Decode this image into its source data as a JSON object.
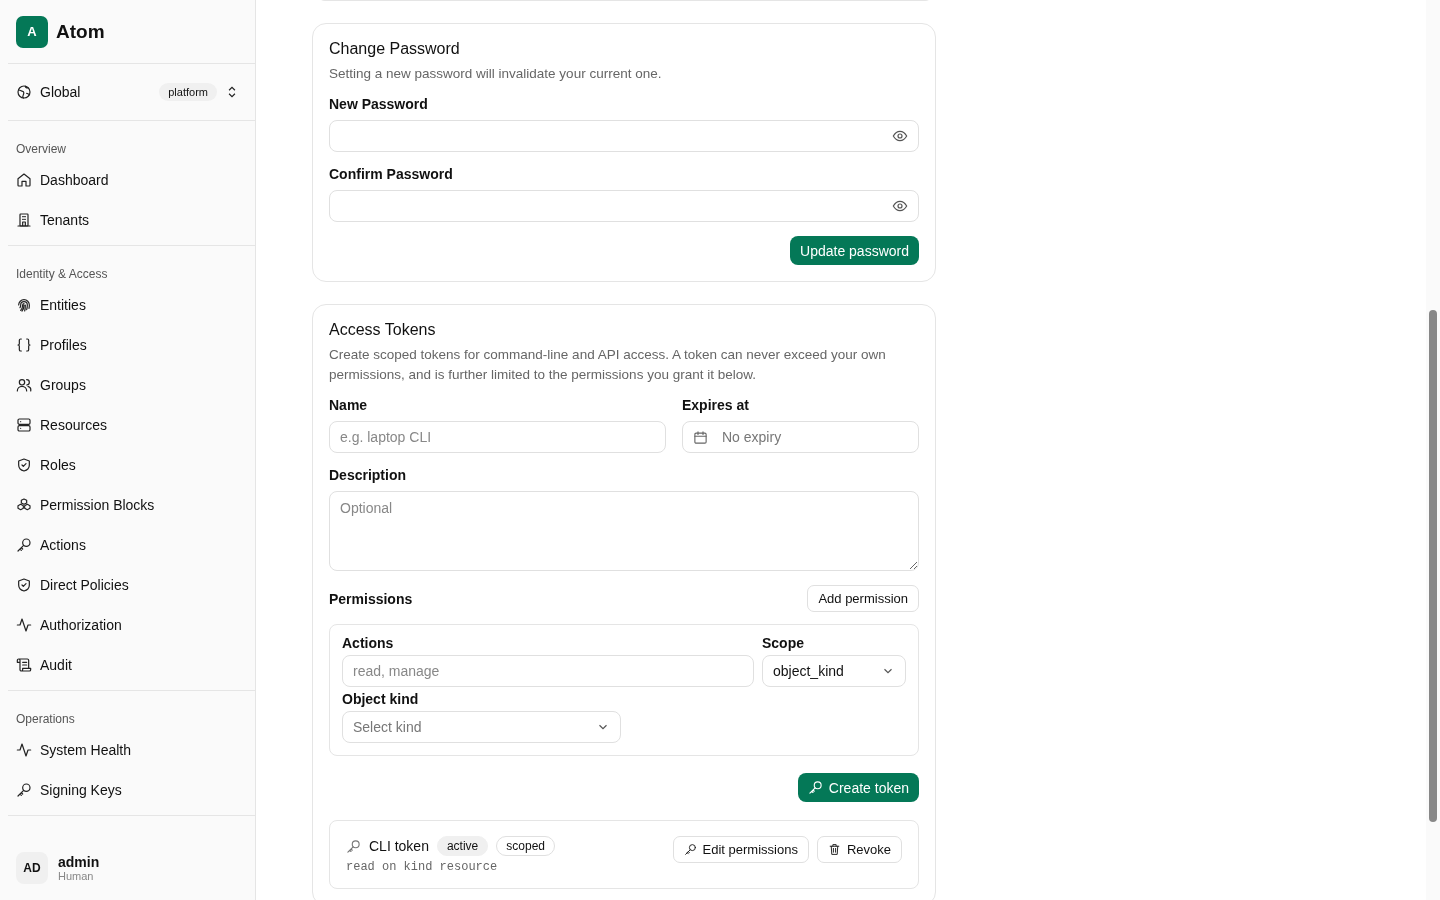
{
  "brand": {
    "initial": "A",
    "name": "Atom"
  },
  "context": {
    "name": "Global",
    "badge": "platform"
  },
  "nav": [
    {
      "section": "Overview",
      "items": [
        {
          "label": "Dashboard",
          "kind": "home"
        },
        {
          "label": "Tenants",
          "kind": "building"
        }
      ]
    },
    {
      "section": "Identity & Access",
      "items": [
        {
          "label": "Entities",
          "kind": "fingerprint"
        },
        {
          "label": "Profiles",
          "kind": "braces"
        },
        {
          "label": "Groups",
          "kind": "users"
        },
        {
          "label": "Resources",
          "kind": "server"
        },
        {
          "label": "Roles",
          "kind": "shield"
        },
        {
          "label": "Permission Blocks",
          "kind": "blocks"
        },
        {
          "label": "Actions",
          "kind": "key"
        },
        {
          "label": "Direct Policies",
          "kind": "shield"
        },
        {
          "label": "Authorization",
          "kind": "activity"
        },
        {
          "label": "Audit",
          "kind": "scroll"
        }
      ]
    },
    {
      "section": "Operations",
      "items": [
        {
          "label": "System Health",
          "kind": "activity"
        },
        {
          "label": "Signing Keys",
          "kind": "key"
        }
      ]
    }
  ],
  "user": {
    "initials": "AD",
    "name": "admin",
    "role": "Human"
  },
  "password_card": {
    "title": "Change Password",
    "description": "Setting a new password will invalidate your current one.",
    "fields": [
      {
        "label": "New Password"
      },
      {
        "label": "Confirm Password"
      }
    ],
    "button": "Update password"
  },
  "tokens_card": {
    "title": "Access Tokens",
    "description": "Create scoped tokens for command-line and API access. A token can never exceed your own permissions, and is further limited to the permissions you grant it below.",
    "name_field": {
      "label": "Name",
      "placeholder": "e.g. laptop CLI"
    },
    "expires_field": {
      "label": "Expires at",
      "value": "No expiry"
    },
    "description_field": {
      "label": "Description",
      "placeholder": "Optional"
    },
    "permissions_label": "Permissions",
    "add_button": "Add permission",
    "permission": {
      "actions_label": "Actions",
      "actions_placeholder": "read, manage",
      "scope_label": "Scope",
      "scope_value": "object_kind",
      "kind_label": "Object kind",
      "kind_placeholder": "Select kind"
    },
    "create_button": "Create token",
    "tokens": [
      {
        "name": "CLI token",
        "badges": [
          {
            "label": "active",
            "kind": "filled"
          },
          {
            "label": "scoped",
            "kind": "outline"
          }
        ],
        "summary": "read on kind resource",
        "edit_button": "Edit permissions",
        "revoke_button": "Revoke"
      }
    ]
  }
}
